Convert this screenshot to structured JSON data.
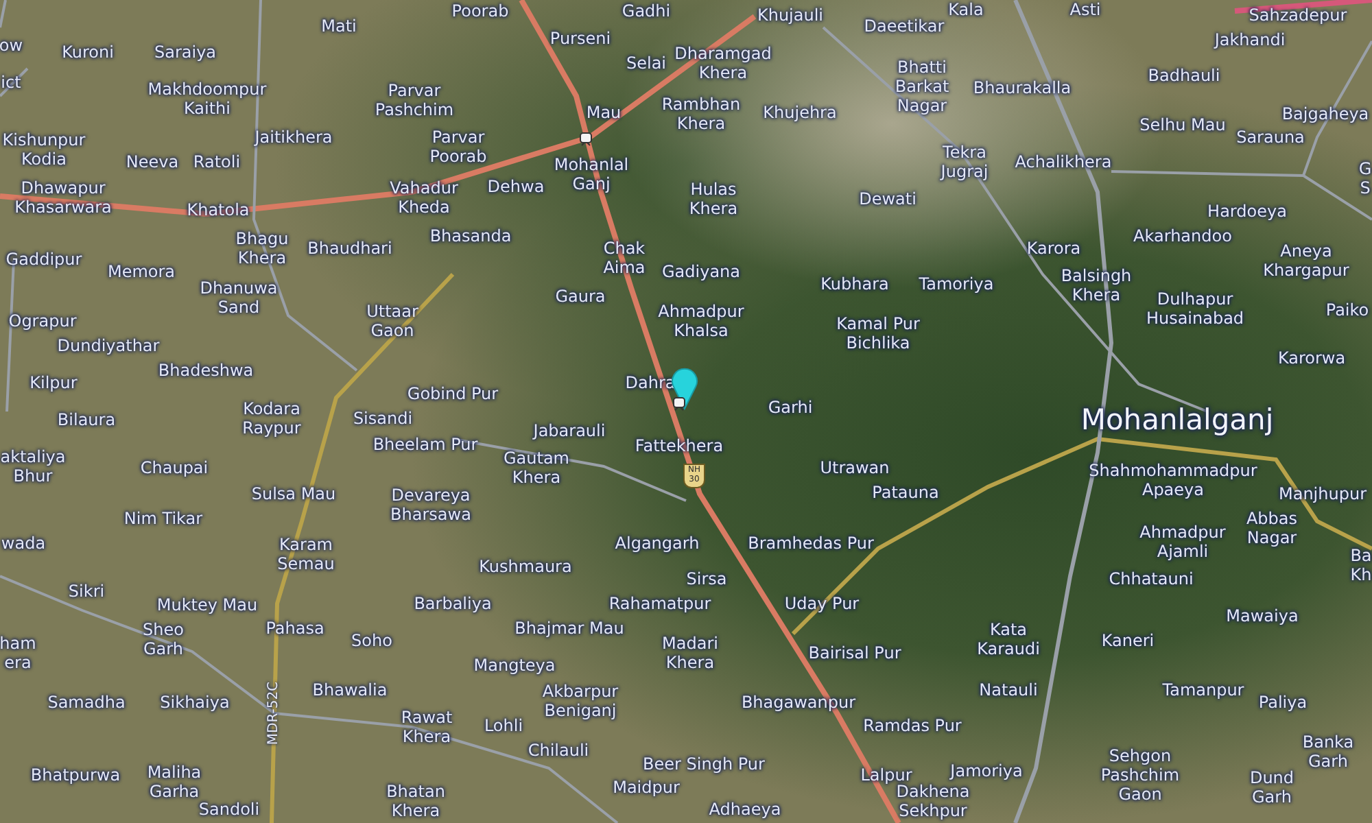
{
  "map": {
    "labels": [
      {
        "lines": [
          "ow"
        ]
      },
      {
        "lines": [
          "Kuroni"
        ]
      },
      {
        "lines": [
          "Saraiya"
        ]
      },
      {
        "lines": [
          "Mati"
        ]
      },
      {
        "lines": [
          "Poorab"
        ]
      },
      {
        "lines": [
          "Gadhi"
        ]
      },
      {
        "lines": [
          "Purseni"
        ]
      },
      {
        "lines": [
          "Selai"
        ]
      },
      {
        "lines": [
          "Dharamgad",
          "Khera"
        ]
      },
      {
        "lines": [
          "Khujauli"
        ]
      },
      {
        "lines": [
          "Daeetikar"
        ]
      },
      {
        "lines": [
          "Kala"
        ]
      },
      {
        "lines": [
          "Asti"
        ]
      },
      {
        "lines": [
          "Sahzadepur"
        ]
      },
      {
        "lines": [
          "Jakhandi"
        ]
      },
      {
        "lines": [
          "ict"
        ]
      },
      {
        "lines": [
          "Makhdoompur",
          "Kaithi"
        ]
      },
      {
        "lines": [
          "Parvar",
          "Pashchim"
        ]
      },
      {
        "lines": [
          "Rambhan",
          "Khera"
        ]
      },
      {
        "lines": [
          "Khujehra"
        ]
      },
      {
        "lines": [
          "Bhatti",
          "Barkat",
          "Nagar"
        ]
      },
      {
        "lines": [
          "Bhaurakalla"
        ]
      },
      {
        "lines": [
          "Badhauli"
        ]
      },
      {
        "lines": [
          "Bajgaheya"
        ]
      },
      {
        "lines": [
          "Kishunpur",
          "Kodia"
        ]
      },
      {
        "lines": [
          "Jaitikhera"
        ]
      },
      {
        "lines": [
          "Neeva"
        ]
      },
      {
        "lines": [
          "Ratoli"
        ]
      },
      {
        "lines": [
          "Parvar",
          "Poorab"
        ]
      },
      {
        "lines": [
          "Mau"
        ]
      },
      {
        "lines": [
          "Mohanlal",
          "Ganj"
        ]
      },
      {
        "lines": [
          "Tekra",
          "Jugraj"
        ]
      },
      {
        "lines": [
          "Achalikhera"
        ]
      },
      {
        "lines": [
          "Selhu Mau"
        ]
      },
      {
        "lines": [
          "Sarauna"
        ]
      },
      {
        "lines": [
          "G",
          "S"
        ]
      },
      {
        "lines": [
          "Dhawapur",
          "Khasarwara"
        ]
      },
      {
        "lines": [
          "Khatola"
        ]
      },
      {
        "lines": [
          "Vahadur",
          "Kheda"
        ]
      },
      {
        "lines": [
          "Dehwa"
        ]
      },
      {
        "lines": [
          "Hulas",
          "Khera"
        ]
      },
      {
        "lines": [
          "Dewati"
        ]
      },
      {
        "lines": [
          "Hardoeya"
        ]
      },
      {
        "lines": [
          "Gaddipur"
        ]
      },
      {
        "lines": [
          "Memora"
        ]
      },
      {
        "lines": [
          "Bhagu",
          "Khera"
        ]
      },
      {
        "lines": [
          "Bhaudhari"
        ]
      },
      {
        "lines": [
          "Bhasanda"
        ]
      },
      {
        "lines": [
          "Chak",
          "Aima"
        ]
      },
      {
        "lines": [
          "Gadiyana"
        ]
      },
      {
        "lines": [
          "Kubhara"
        ]
      },
      {
        "lines": [
          "Tamoriya"
        ]
      },
      {
        "lines": [
          "Karora"
        ]
      },
      {
        "lines": [
          "Akarhandoo"
        ]
      },
      {
        "lines": [
          "Aneya",
          "Khargapur"
        ]
      },
      {
        "lines": [
          "Balsingh",
          "Khera"
        ]
      },
      {
        "lines": [
          "Paiko"
        ]
      },
      {
        "lines": [
          "Ograpur"
        ]
      },
      {
        "lines": [
          "Dhanuwa",
          "Sand"
        ]
      },
      {
        "lines": [
          "Uttaar",
          "Gaon"
        ]
      },
      {
        "lines": [
          "Gaura"
        ]
      },
      {
        "lines": [
          "Ahmadpur",
          "Khalsa"
        ]
      },
      {
        "lines": [
          "Kamal Pur",
          "Bichlika"
        ]
      },
      {
        "lines": [
          "Dulhapur",
          "Husainabad"
        ]
      },
      {
        "lines": [
          "Dundiyathar"
        ]
      },
      {
        "lines": [
          "Bhadeshwa"
        ]
      },
      {
        "lines": [
          "Karorwa"
        ]
      },
      {
        "lines": [
          "Kilpur"
        ]
      },
      {
        "lines": [
          "Dahra"
        ]
      },
      {
        "lines": [
          "Gobind Pur"
        ]
      },
      {
        "lines": [
          "Garhi"
        ]
      },
      {
        "lines": [
          "Bilaura"
        ]
      },
      {
        "lines": [
          "Kodara",
          "Raypur"
        ]
      },
      {
        "lines": [
          "Sisandi"
        ]
      },
      {
        "lines": [
          "aktaliya",
          "Bhur"
        ]
      },
      {
        "lines": [
          "Bheelam Pur"
        ]
      },
      {
        "lines": [
          "Chaupai"
        ]
      },
      {
        "lines": [
          "Sulsa Mau"
        ]
      },
      {
        "lines": [
          "Nim Tikar"
        ]
      },
      {
        "lines": [
          "Devareya",
          "Bharsawa"
        ]
      },
      {
        "lines": [
          "Jabarauli"
        ]
      },
      {
        "lines": [
          "Gautam",
          "Khera"
        ]
      },
      {
        "lines": [
          "Fattekhera"
        ]
      },
      {
        "lines": [
          "Utrawan"
        ]
      },
      {
        "lines": [
          "Patauna"
        ]
      },
      {
        "lines": [
          "Shahmohammadpur",
          "Apaeya"
        ]
      },
      {
        "lines": [
          "Manjhupur"
        ]
      },
      {
        "lines": [
          "wada"
        ]
      },
      {
        "lines": [
          "Karam",
          "Semau"
        ]
      },
      {
        "lines": [
          "Algangarh"
        ]
      },
      {
        "lines": [
          "Bramhedas Pur"
        ]
      },
      {
        "lines": [
          "Kushmaura"
        ]
      },
      {
        "lines": [
          "Ahmadpur",
          "Ajamli"
        ]
      },
      {
        "lines": [
          "Abbas",
          "Nagar"
        ]
      },
      {
        "lines": [
          "Sikri"
        ]
      },
      {
        "lines": [
          "Sirsa"
        ]
      },
      {
        "lines": [
          "Chhatauni"
        ]
      },
      {
        "lines": [
          "Ba",
          "Kh"
        ]
      },
      {
        "lines": [
          "Muktey Mau"
        ]
      },
      {
        "lines": [
          "Barbaliya"
        ]
      },
      {
        "lines": [
          "Rahamatpur"
        ]
      },
      {
        "lines": [
          "Uday Pur"
        ]
      },
      {
        "lines": [
          "ham",
          "era"
        ]
      },
      {
        "lines": [
          "Sheo",
          "Garh"
        ]
      },
      {
        "lines": [
          "Pahasa"
        ]
      },
      {
        "lines": [
          "Soho"
        ]
      },
      {
        "lines": [
          "Bhajmar Mau"
        ]
      },
      {
        "lines": [
          "Mangteya"
        ]
      },
      {
        "lines": [
          "Madari",
          "Khera"
        ]
      },
      {
        "lines": [
          "Bairisal Pur"
        ]
      },
      {
        "lines": [
          "Kata",
          "Karaudi"
        ]
      },
      {
        "lines": [
          "Kaneri"
        ]
      },
      {
        "lines": [
          "Mawaiya"
        ]
      },
      {
        "lines": [
          "Samadha"
        ]
      },
      {
        "lines": [
          "Sikhaiya"
        ]
      },
      {
        "lines": [
          "Bhawalia"
        ]
      },
      {
        "lines": [
          "Rawat",
          "Khera"
        ]
      },
      {
        "lines": [
          "Lohli"
        ]
      },
      {
        "lines": [
          "Akbarpur",
          "Beniganj"
        ]
      },
      {
        "lines": [
          "Bhagawanpur"
        ]
      },
      {
        "lines": [
          "Ramdas Pur"
        ]
      },
      {
        "lines": [
          "Natauli"
        ]
      },
      {
        "lines": [
          "Tamanpur"
        ]
      },
      {
        "lines": [
          "Paliya"
        ]
      },
      {
        "lines": [
          "Chilauli"
        ]
      },
      {
        "lines": [
          "Bhatpurwa"
        ]
      },
      {
        "lines": [
          "Maliha",
          "Garha"
        ]
      },
      {
        "lines": [
          "Beer Singh Pur"
        ]
      },
      {
        "lines": [
          "Sandoli"
        ]
      },
      {
        "lines": [
          "Bhatan",
          "Khera"
        ]
      },
      {
        "lines": [
          "Maidpur"
        ]
      },
      {
        "lines": [
          "Adhaeya"
        ]
      },
      {
        "lines": [
          "Lalpur"
        ]
      },
      {
        "lines": [
          "Jamoriya"
        ]
      },
      {
        "lines": [
          "Dakhena",
          "Sekhpur"
        ]
      },
      {
        "lines": [
          "Sehgon",
          "Pashchim",
          "Gaon"
        ]
      },
      {
        "lines": [
          "Banka",
          "Garh"
        ]
      },
      {
        "lines": [
          "Dund",
          "Garh"
        ]
      }
    ],
    "city_label": "Mohanlalganj",
    "highway_shield": {
      "lines": [
        "NH",
        "30"
      ]
    },
    "road_label": "MDR-52C"
  }
}
